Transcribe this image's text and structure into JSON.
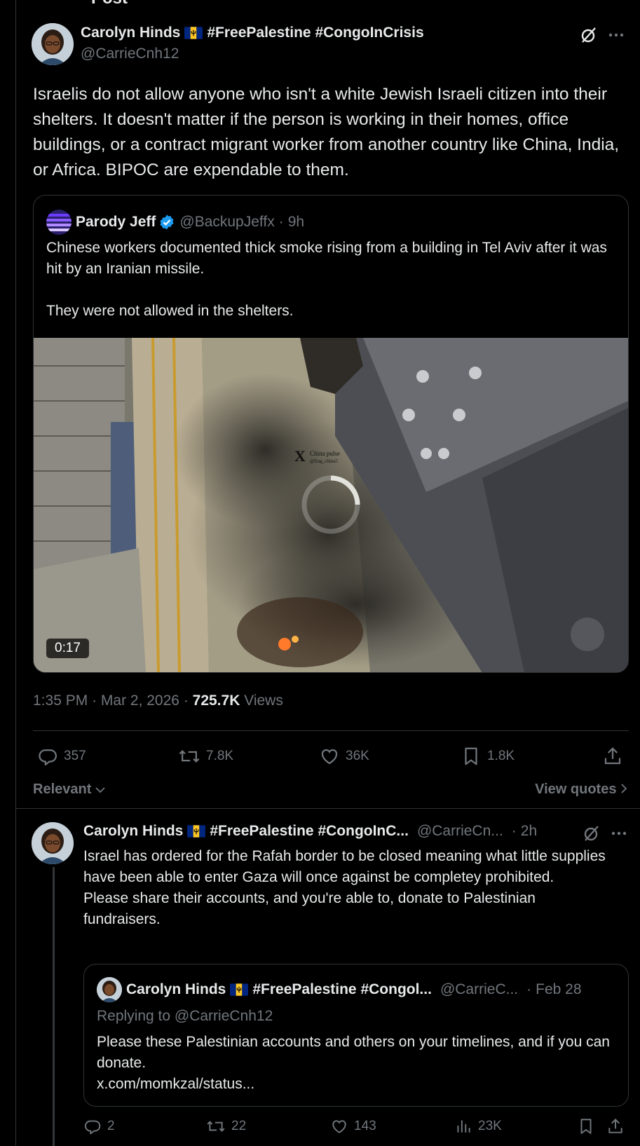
{
  "page": {
    "header_title": "Post"
  },
  "post": {
    "author_name": "Carolyn Hinds",
    "author_tags": "#FreePalestine #CongoInCrisis",
    "handle": "@CarrieCnh12",
    "text": "Israelis do not allow anyone who isn't a white Jewish Israeli citizen into their shelters. It doesn't matter if the person is working in their homes, office buildings, or a contract migrant worker from another country like China, India, or Africa. BIPOC are expendable to them.",
    "time": "1:35 PM",
    "date": "Mar 2, 2026",
    "views_count": "725.7K",
    "views_label": "Views",
    "stats": {
      "replies": "357",
      "reposts": "7.8K",
      "likes": "36K",
      "bookmarks": "1.8K"
    },
    "sort_label": "Relevant",
    "view_quotes_label": "View quotes"
  },
  "quote": {
    "author_name": "Parody Jeff",
    "handle": "@BackupJeffx",
    "time_ago": "9h",
    "text": "Chinese workers documented thick smoke rising from a building in Tel Aviv after it was hit by an Iranian missile.\n\nThey were not allowed in the shelters.",
    "video_duration": "0:17",
    "watermark_line1": "China pulse",
    "watermark_line2": "@Eng_china5"
  },
  "reply": {
    "author_name": "Carolyn Hinds",
    "author_tags": "#FreePalestine #CongoInC...",
    "handle": "@CarrieCn...",
    "time_ago": "2h",
    "text": "Israel has ordered for the Rafah border to be closed meaning what little supplies have been able to enter Gaza will once against be completey prohibited.\nPlease share their accounts, and you're able to, donate to Palestinian fundraisers.",
    "stats": {
      "replies": "2",
      "reposts": "22",
      "likes": "143",
      "views": "23K"
    }
  },
  "inner_quote": {
    "author_name": "Carolyn Hinds",
    "author_tags": "#FreePalestine #Congol...",
    "handle": "@CarrieC...",
    "date": "Feb 28",
    "replying_to": "Replying to @CarrieCnh12",
    "text": "Please these Palestinian accounts and others on your timelines, and if you can donate.\nx.com/momkzal/status..."
  },
  "colors": {
    "background": "#000000",
    "text_primary": "#e7e9ea",
    "text_secondary": "#71767b",
    "border": "#2f3336",
    "verified_blue": "#1d9bf0",
    "flag_blue": "#00267f",
    "flag_gold": "#ffc726"
  },
  "icons": [
    "grok-icon",
    "more-icon",
    "verified-icon",
    "flag-barbados-icon",
    "reply-icon",
    "repost-icon",
    "like-icon",
    "bookmark-icon",
    "share-icon",
    "views-icon",
    "chevron-down-icon",
    "chevron-right-icon",
    "loading-spinner-icon"
  ]
}
